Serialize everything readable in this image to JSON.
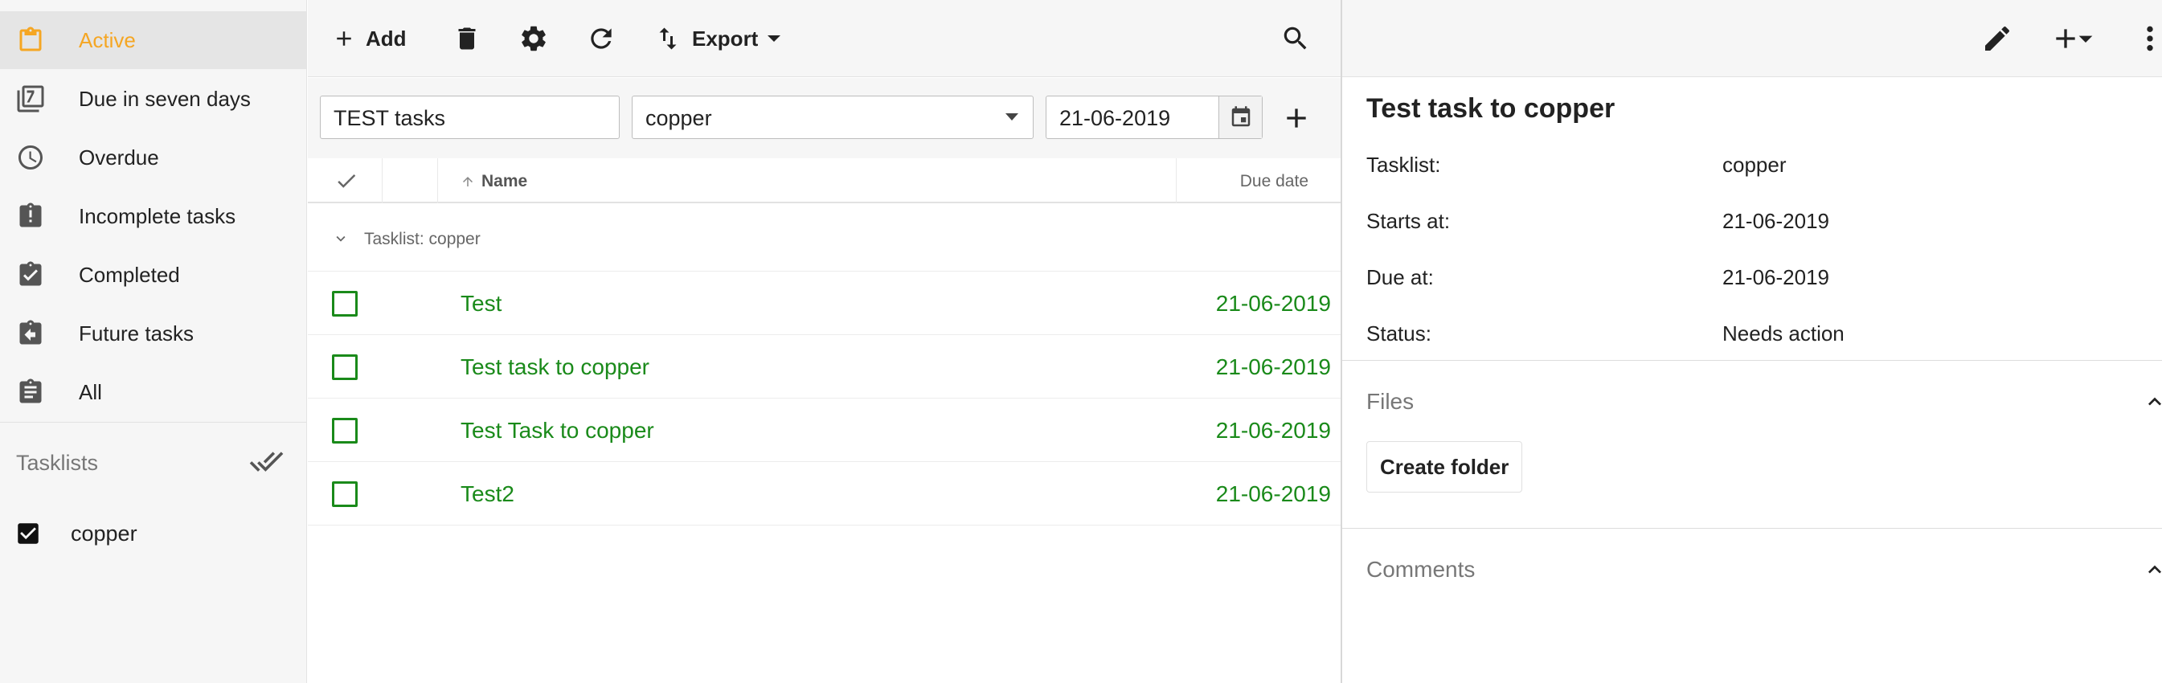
{
  "colors": {
    "accent": "#f5a623",
    "task_green": "#1a8a1a",
    "sidebar_bg": "#f6f6f6"
  },
  "sidebar": {
    "items": [
      {
        "label": "Active",
        "icon": "clipboard-icon",
        "active": true
      },
      {
        "label": "Due in seven days",
        "icon": "calendar-seven-icon"
      },
      {
        "label": "Overdue",
        "icon": "clock-icon"
      },
      {
        "label": "Incomplete tasks",
        "icon": "clipboard-alert-icon"
      },
      {
        "label": "Completed",
        "icon": "clipboard-check-icon"
      },
      {
        "label": "Future tasks",
        "icon": "clipboard-arrow-left-icon"
      },
      {
        "label": "All",
        "icon": "clipboard-text-icon"
      }
    ],
    "tasklists_heading": "Tasklists",
    "tasklists": [
      {
        "label": "copper",
        "checked": true
      }
    ]
  },
  "toolbar": {
    "add_label": "Add",
    "export_label": "Export"
  },
  "filters": {
    "search_value": "TEST tasks",
    "tasklist_value": "copper",
    "date_value": "21-06-2019"
  },
  "grid": {
    "columns": {
      "name": "Name",
      "due": "Due date"
    },
    "group_label": "Tasklist: copper",
    "rows": [
      {
        "name": "Test",
        "due": "21-06-2019"
      },
      {
        "name": "Test task to copper",
        "due": "21-06-2019"
      },
      {
        "name": "Test Task to copper",
        "due": "21-06-2019"
      },
      {
        "name": "Test2",
        "due": "21-06-2019"
      }
    ]
  },
  "detail": {
    "title": "Test task to copper",
    "properties": [
      {
        "key": "Tasklist:",
        "value": "copper"
      },
      {
        "key": "Starts at:",
        "value": "21-06-2019"
      },
      {
        "key": "Due at:",
        "value": "21-06-2019"
      },
      {
        "key": "Status:",
        "value": "Needs action"
      }
    ],
    "files_heading": "Files",
    "create_folder_label": "Create folder",
    "comments_heading": "Comments"
  }
}
